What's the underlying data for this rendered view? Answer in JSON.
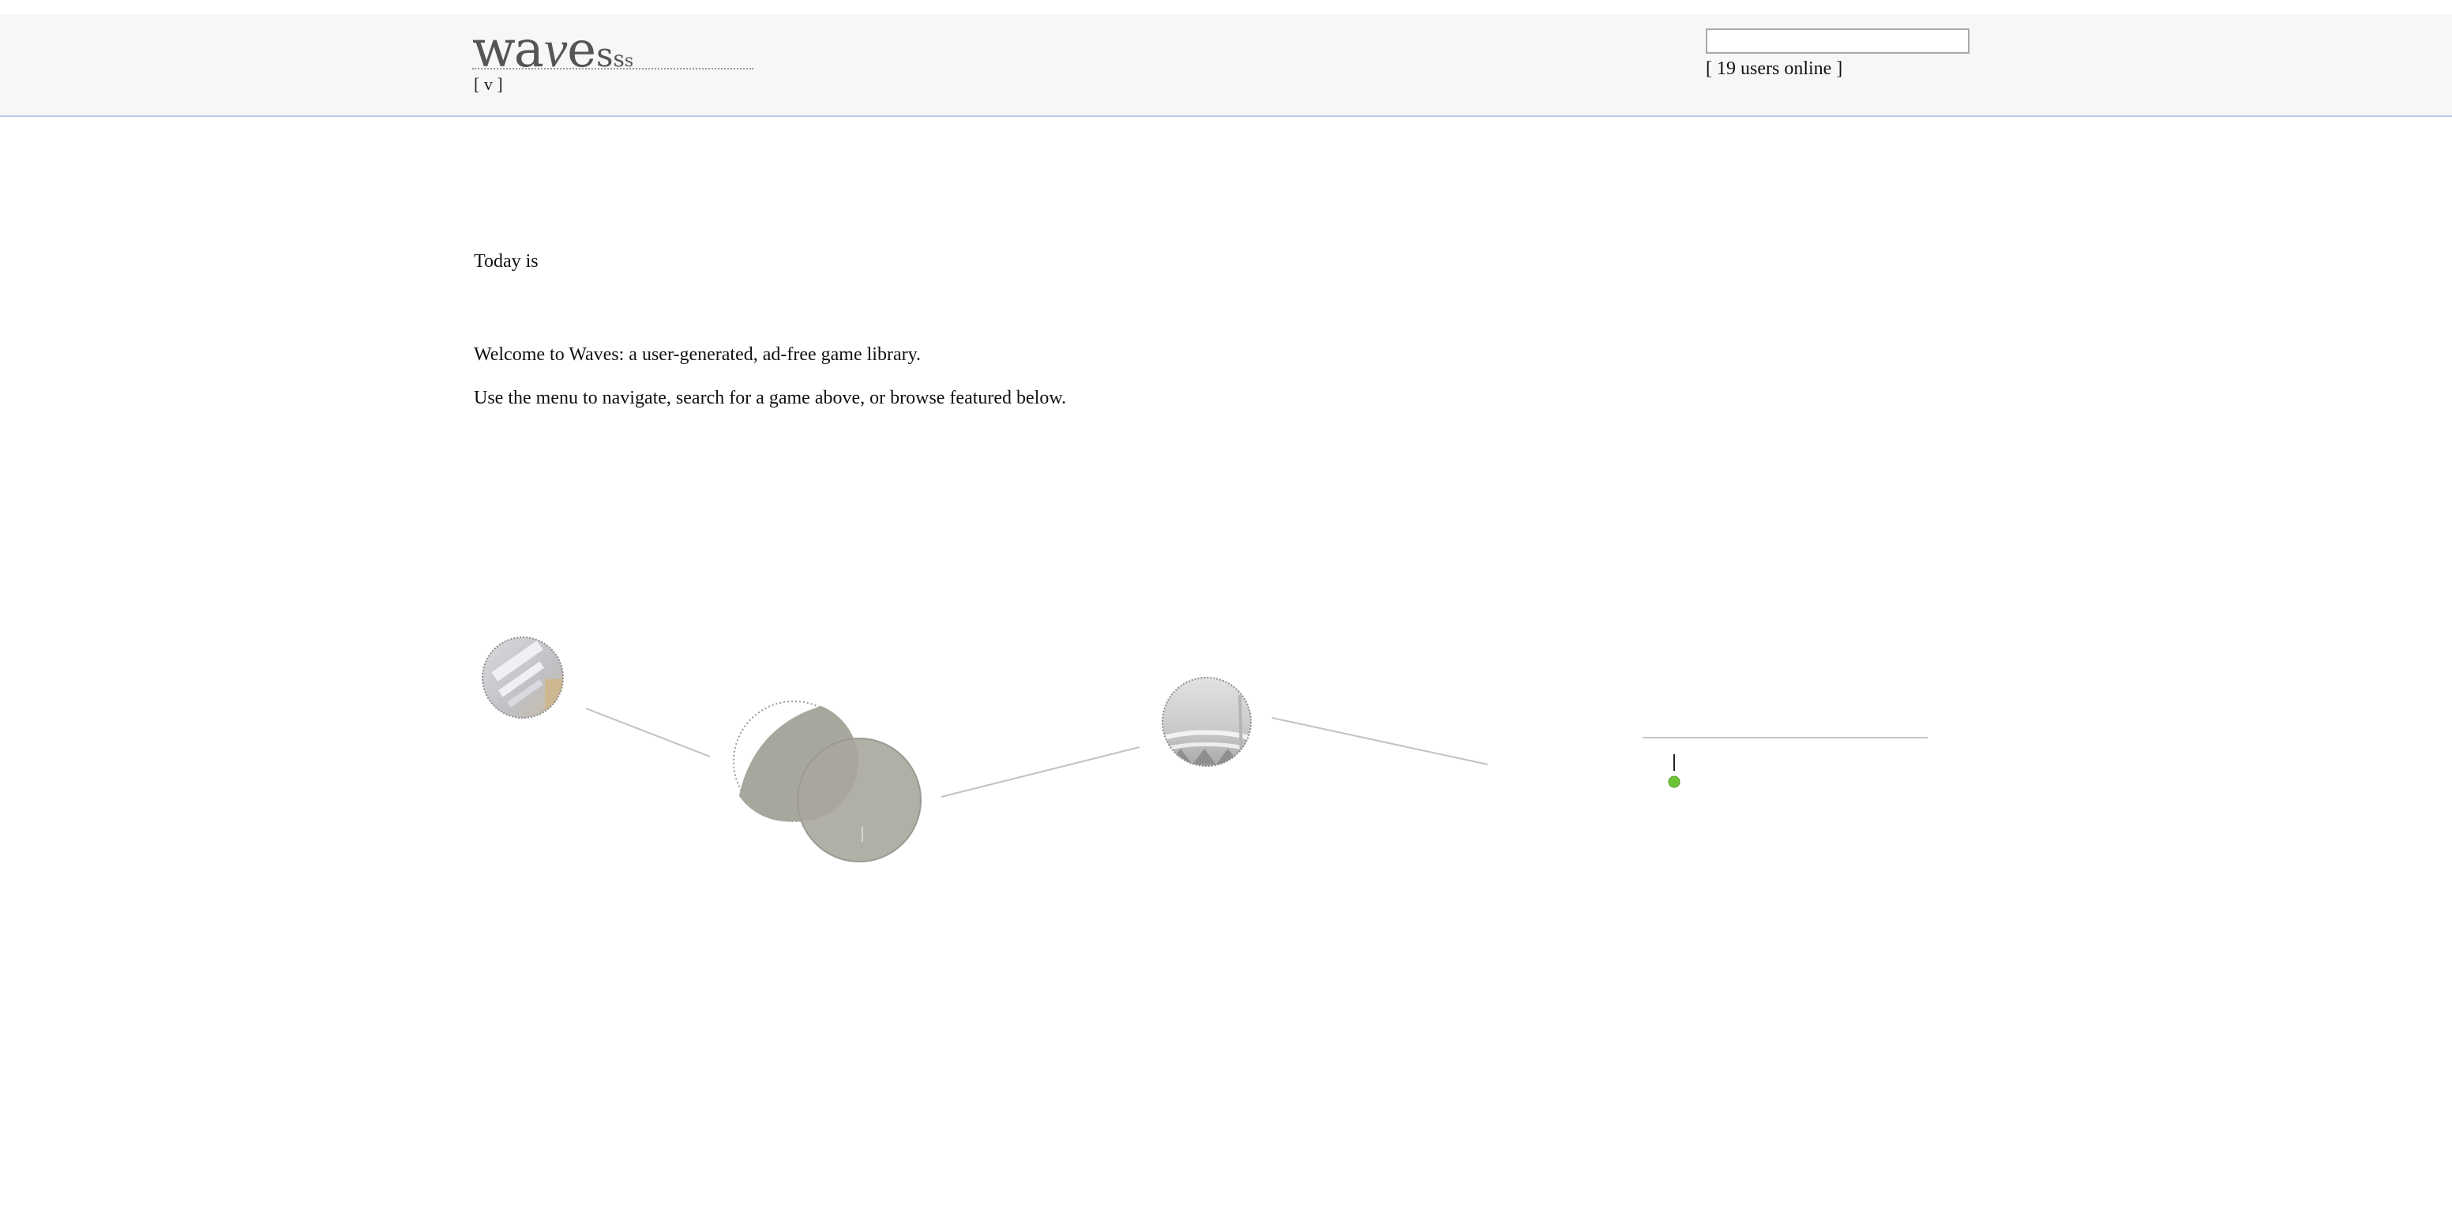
{
  "header": {
    "logo": {
      "w": "w",
      "a": "a",
      "v": "v",
      "e": "e",
      "s1": "s",
      "s2": "s",
      "s3": "s"
    },
    "menu_toggle_label": "[ v ]",
    "search": {
      "value": "",
      "placeholder": ""
    },
    "users_online_label": "[ 19 users online ]"
  },
  "main": {
    "today_label": "Today is",
    "welcome_text": "Welcome to Waves: a user-generated, ad-free game library.",
    "instructions_text": "Use the menu to navigate, search for a game above, or browse featured below."
  },
  "colors": {
    "header_bg": "#f7f7f7",
    "header_border": "#b9cbea",
    "logo_text": "#555555",
    "blob": "#a8a79d",
    "connector": "#c2c2c2",
    "online_dot": "#6cc434"
  },
  "featured": {
    "items": [
      {
        "icon": "game-thumbnail-icon"
      },
      {
        "icon": "game-thumbnail-icon"
      },
      {
        "icon": "game-thumbnail-icon"
      },
      {
        "icon": "status-dot-icon"
      }
    ]
  }
}
